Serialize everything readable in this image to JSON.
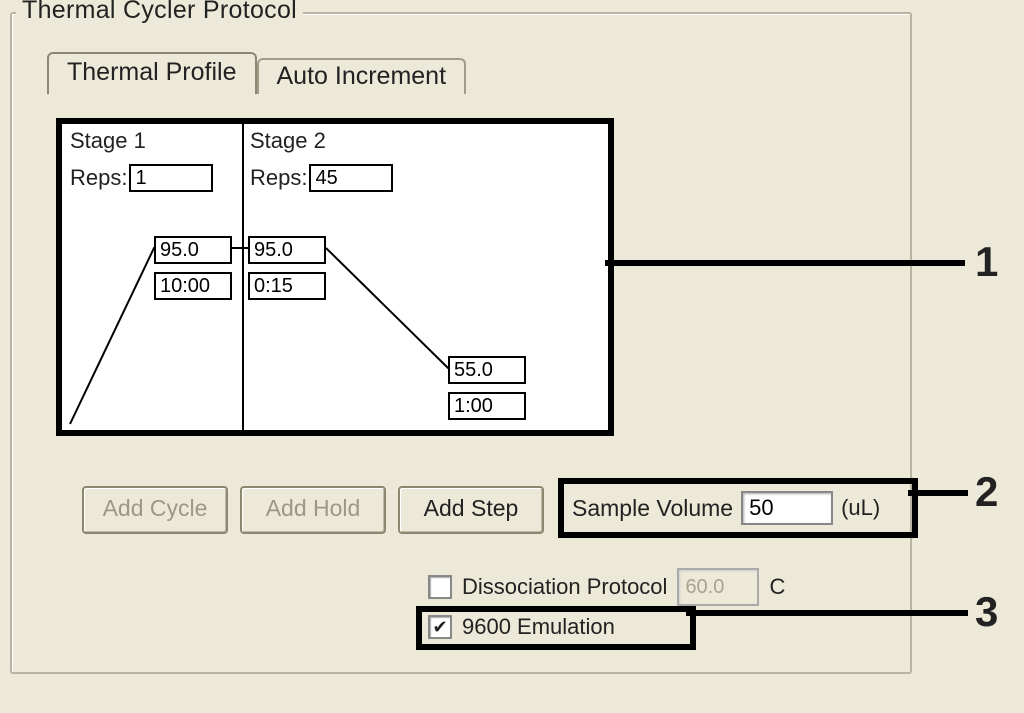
{
  "group_title": "Thermal Cycler Protocol",
  "tabs": {
    "thermal_profile": "Thermal Profile",
    "auto_increment": "Auto Increment"
  },
  "profile": {
    "stage1": {
      "label": "Stage 1",
      "reps_label": "Reps:",
      "reps_value": "1",
      "steps": [
        {
          "temp": "95.0",
          "time": "10:00"
        }
      ]
    },
    "stage2": {
      "label": "Stage 2",
      "reps_label": "Reps:",
      "reps_value": "45",
      "steps": [
        {
          "temp": "95.0",
          "time": "0:15"
        },
        {
          "temp": "55.0",
          "time": "1:00"
        }
      ]
    }
  },
  "buttons": {
    "add_cycle": "Add Cycle",
    "add_hold": "Add Hold",
    "add_step": "Add Step"
  },
  "sample_volume": {
    "label": "Sample Volume",
    "value": "50",
    "unit": "(uL)"
  },
  "dissociation": {
    "checked": false,
    "label": "Dissociation Protocol",
    "temp": "60.0",
    "unit": "C"
  },
  "emulation": {
    "checked": true,
    "label": "9600 Emulation",
    "check_glyph": "✔"
  },
  "callouts": {
    "c1": "1",
    "c2": "2",
    "c3": "3"
  }
}
